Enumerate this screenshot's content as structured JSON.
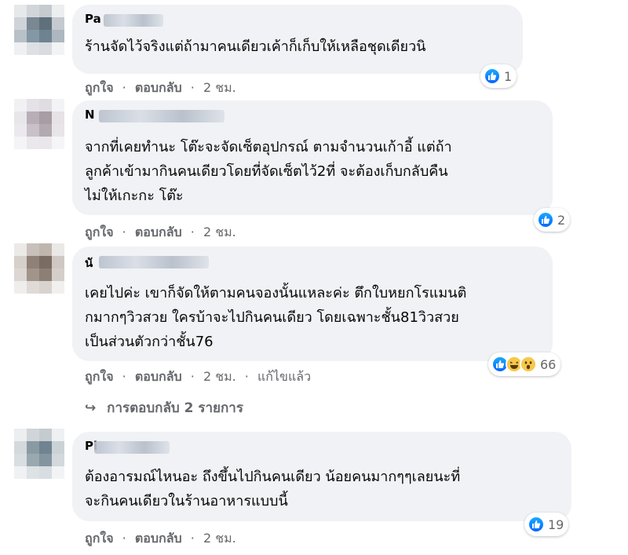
{
  "comments": [
    {
      "author": "Pa",
      "lines": [
        "ร้านจัดไว้จริงแต่ถ้ามาคนเดียวเค้าก็เก็บให้เหลือชุดเดียวนิ"
      ],
      "reaction_count": "1",
      "reaction_icons": [
        "like-icon"
      ],
      "like": "ถูกใจ",
      "reply": "ตอบกลับ",
      "time": "2 ชม."
    },
    {
      "author": "N",
      "lines": [
        "จากที่เคยทำนะ โต๊ะจะจัดเซ็ตอุปกรณ์ ตามจำนวนเก้าอี้ แต่ถ้า",
        "ลูกค้าเข้ามากินคนเดียวโดยที่จัดเซ็ตไว้2ที่ จะต้องเก็บกลับคืน",
        "ไม่ให้เกะกะ โต๊ะ"
      ],
      "reaction_count": "2",
      "reaction_icons": [
        "like-icon"
      ],
      "like": "ถูกใจ",
      "reply": "ตอบกลับ",
      "time": "2 ชม."
    },
    {
      "author": "นั",
      "lines": [
        "เคยไปค่ะ เขาก็จัดให้ตามคนจองนั้นแหละค่ะ ตึกใบหยกโรแมนติ",
        "กมากๆวิวสวย ใครบ้าจะไปกินคนเดียว โดยเฉพาะชั้น81วิวสวย",
        "เป็นส่วนตัวกว่าชั้น76"
      ],
      "reaction_count": "66",
      "reaction_icons": [
        "like-icon",
        "haha-icon",
        "wow-icon"
      ],
      "like": "ถูกใจ",
      "reply": "ตอบกลับ",
      "time": "2 ชม.",
      "edited": "แก้ไขแล้ว"
    },
    {
      "author": "Pi",
      "lines": [
        "ต้องอารมณ์ไหนอะ ถึงขึ้นไปกินคนเดียว น้อยคนมากๆๆเลยนะที่",
        "จะกินคนเดียวในร้านอาหารแบบนี้"
      ],
      "reaction_count": "19",
      "reaction_icons": [
        "like-icon"
      ],
      "like": "ถูกใจ",
      "reply": "ตอบกลับ",
      "time": "2 ชม."
    }
  ],
  "replies_link": {
    "arrow": "↪",
    "label": "การตอบกลับ 2 รายการ"
  },
  "separator": "·",
  "colors": {
    "bubble": "#f0f2f5",
    "secondary_text": "#65676b",
    "like_blue": "#0866ff",
    "emoji_yellow": "#f7c94b"
  }
}
